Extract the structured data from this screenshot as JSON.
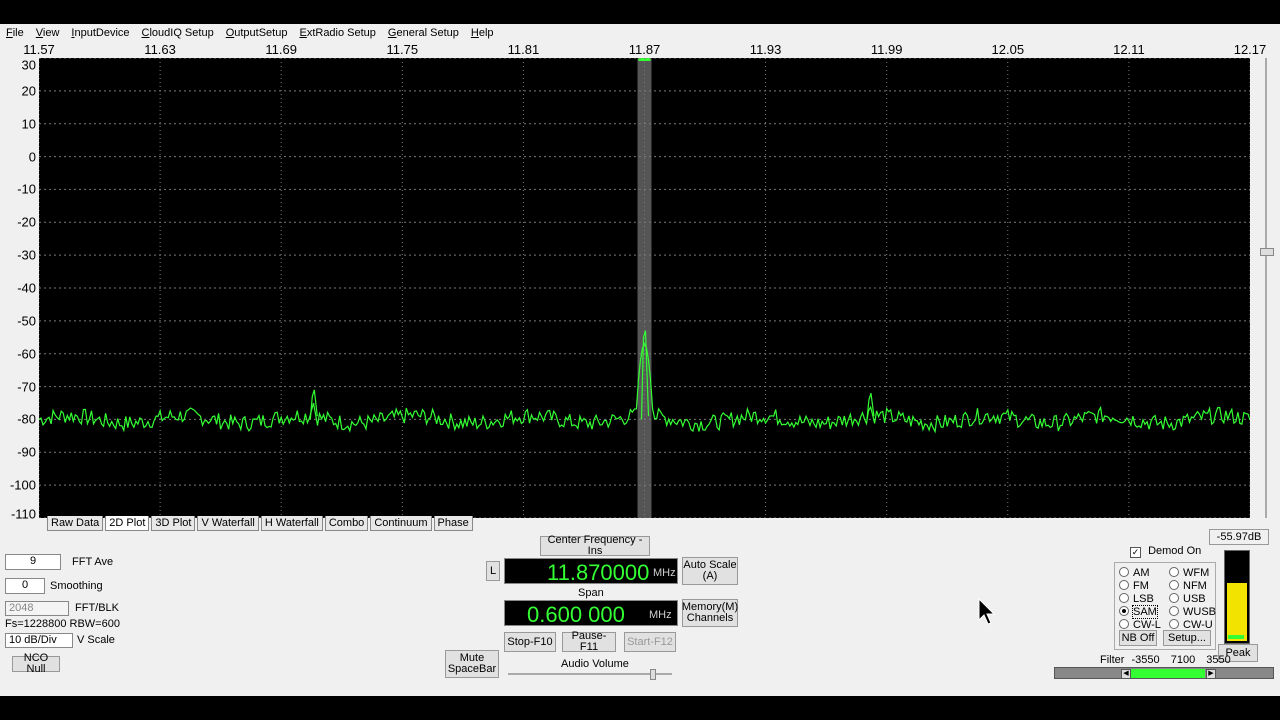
{
  "menu": [
    "File",
    "View",
    "InputDevice",
    "CloudIQ Setup",
    "OutputSetup",
    "ExtRadio Setup",
    "General Setup",
    "Help"
  ],
  "x_axis": [
    "11.57",
    "11.63",
    "11.69",
    "11.75",
    "11.81",
    "11.87",
    "11.93",
    "11.99",
    "12.05",
    "12.11",
    "12.17"
  ],
  "y_axis": [
    "30",
    "20",
    "10",
    "0",
    "-10",
    "-20",
    "-30",
    "-40",
    "-50",
    "-60",
    "-70",
    "-80",
    "-90",
    "-100",
    "-110"
  ],
  "tabs": [
    "Raw Data",
    "2D Plot",
    "3D Plot",
    "V Waterfall",
    "H Waterfall",
    "Combo",
    "Continuum",
    "Phase"
  ],
  "active_tab": "2D Plot",
  "controls": {
    "fft_ave_value": "9",
    "fft_ave_label": "FFT Ave",
    "smoothing_value": "0",
    "smoothing_label": "Smoothing",
    "fft_blk_value": "2048",
    "fft_blk_label": "FFT/BLK",
    "fs_rbw": "Fs=1228800 RBW=600",
    "vscale_value": "10 dB/Div",
    "vscale_label": "V Scale",
    "nco_null": "NCO Null"
  },
  "center": {
    "button": "Center Frequency - Ins",
    "l_button": "L",
    "frequency": "11.870000",
    "freq_unit": "MHz",
    "span_label": "Span",
    "span": "0.600 000",
    "span_unit": "MHz",
    "auto_scale_1": "Auto Scale",
    "auto_scale_2": "(A)",
    "memory_1": "Memory(M)",
    "memory_2": "Channels",
    "stop": "Stop-F10",
    "pause": "Pause-F11",
    "start": "Start-F12",
    "mute_1": "Mute",
    "mute_2": "SpaceBar",
    "audio_volume": "Audio Volume"
  },
  "demod": {
    "db_readout": "-55.97dB",
    "demod_on": "Demod On",
    "modes_left": [
      "AM",
      "FM",
      "LSB",
      "SAM",
      "CW-L"
    ],
    "modes_right": [
      "WFM",
      "NFM",
      "USB",
      "WUSB",
      "CW-U"
    ],
    "selected": "SAM",
    "nb_off": "NB Off",
    "setup": "Setup...",
    "peak": "Peak",
    "filter_label": "Filter",
    "filter_values": [
      "-3550",
      "7100",
      "3550"
    ]
  },
  "colors": {
    "trace": "#33ff33",
    "grid": "#7a7a7a",
    "background": "#000000"
  },
  "chart_data": {
    "type": "line",
    "xlim": [
      11.57,
      12.17
    ],
    "ylim": [
      -110,
      30
    ],
    "noise_floor_db": -80,
    "peaks": [
      {
        "x": 11.7059,
        "y": -73
      },
      {
        "x": 11.87,
        "y": -55
      },
      {
        "x": 11.9817,
        "y": -74
      }
    ]
  }
}
